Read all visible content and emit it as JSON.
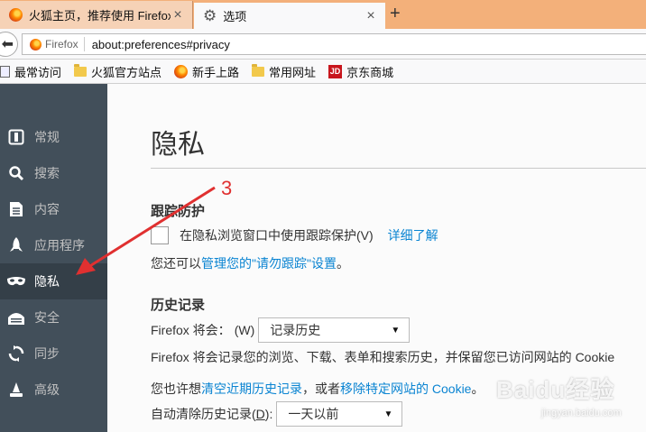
{
  "tabs": [
    {
      "title": "火狐主页，推荐使用 Firefox",
      "close": "×"
    },
    {
      "title": "选项",
      "close": "×"
    }
  ],
  "new_tab": "+",
  "navbar": {
    "identity": "Firefox",
    "url": "about:preferences#privacy"
  },
  "bookmarks": [
    {
      "label": "最常访问",
      "icon": "page-icon"
    },
    {
      "label": "火狐官方站点",
      "icon": "folder-icon"
    },
    {
      "label": "新手上路",
      "icon": "firefox-icon"
    },
    {
      "label": "常用网址",
      "icon": "folder-icon"
    },
    {
      "label": "京东商城",
      "icon": "jd-icon",
      "badge": "JD"
    }
  ],
  "sidebar": {
    "items": [
      {
        "label": "常规",
        "icon": "general-icon"
      },
      {
        "label": "搜索",
        "icon": "search-icon"
      },
      {
        "label": "内容",
        "icon": "content-icon"
      },
      {
        "label": "应用程序",
        "icon": "applications-icon"
      },
      {
        "label": "隐私",
        "icon": "privacy-mask-icon",
        "active": true
      },
      {
        "label": "安全",
        "icon": "security-icon"
      },
      {
        "label": "同步",
        "icon": "sync-icon"
      },
      {
        "label": "高级",
        "icon": "advanced-icon"
      }
    ]
  },
  "page": {
    "title": "隐私",
    "tracking": {
      "heading": "跟踪防护",
      "checkbox_label": "在隐私浏览窗口中使用跟踪保护(V)",
      "learn_more": "详细了解",
      "dnt_prefix": "您还可以",
      "dnt_link": "管理您的\"请勿跟踪\"设置",
      "dnt_suffix": "。"
    },
    "history": {
      "heading": "历史记录",
      "will_label": "Firefox 将会：",
      "will_key": "(W)",
      "will_value": "记录历史",
      "desc": "Firefox 将会记录您的浏览、下载、表单和搜索历史，并保留您已访问网站的 Cookie",
      "clear_prefix": "您也许想",
      "clear_link": "清空近期历史记录",
      "clear_mid": "，或者",
      "remove_link": "移除特定网站的 Cookie",
      "clear_suffix": "。",
      "auto_label": "自动清除历史记录(",
      "auto_key": "D",
      "auto_suffix": "):",
      "auto_value": "一天以前"
    }
  },
  "annotation": {
    "number": "3",
    "color": "#e03030"
  },
  "watermark": {
    "text": "Baidu经验",
    "sub": "jingyan.baidu.com"
  },
  "colors": {
    "sidebar": "#424f5a",
    "sidebar_active": "#343f48",
    "link": "#0a84d2",
    "tabstrip": "#f3b07a"
  }
}
